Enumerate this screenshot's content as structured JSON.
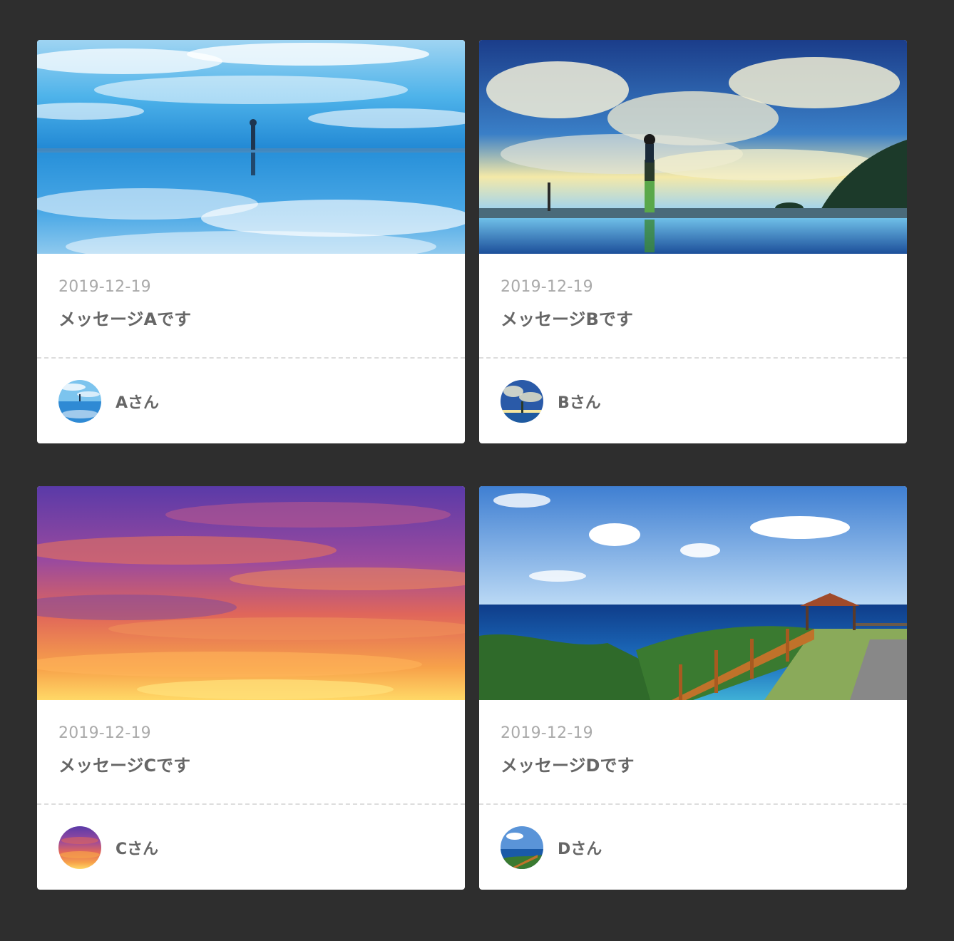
{
  "cards": [
    {
      "date": "2019-12-19",
      "message": "メッセージAです",
      "author": "Aさん",
      "image": "salt-flat-reflection-sky"
    },
    {
      "date": "2019-12-19",
      "message": "メッセージBです",
      "author": "Bさん",
      "image": "cloudy-sky-beach-reflection"
    },
    {
      "date": "2019-12-19",
      "message": "メッセージCです",
      "author": "Cさん",
      "image": "purple-orange-sunset-sky"
    },
    {
      "date": "2019-12-19",
      "message": "メッセージDです",
      "author": "Dさん",
      "image": "ocean-cliff-gazebo"
    }
  ]
}
